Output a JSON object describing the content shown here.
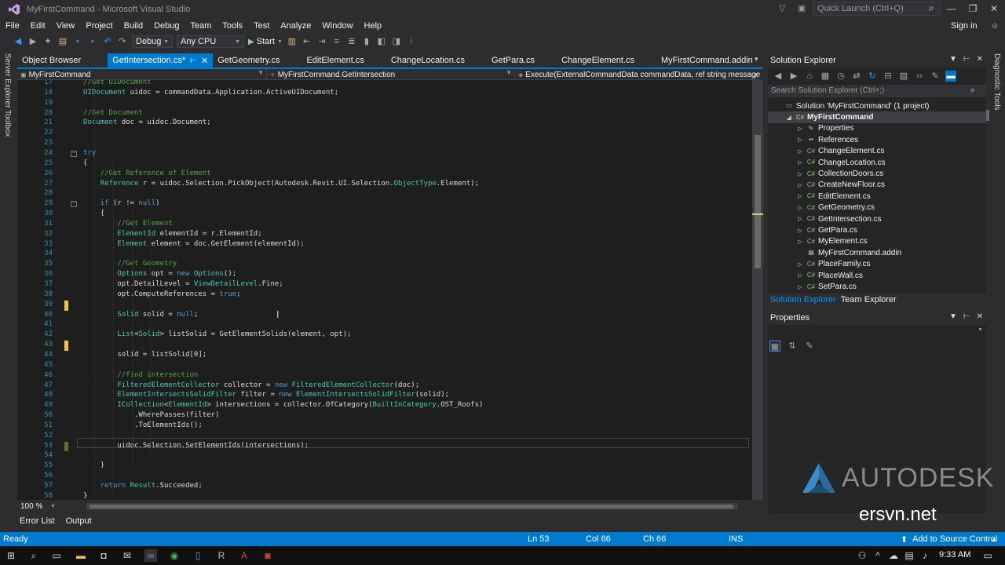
{
  "window": {
    "title": "MyFirstCommand - Microsoft Visual Studio",
    "quick_launch_placeholder": "Quick Launch (Ctrl+Q)",
    "sign_in": "Sign in"
  },
  "menu": [
    "File",
    "Edit",
    "View",
    "Project",
    "Build",
    "Debug",
    "Team",
    "Tools",
    "Test",
    "Analyze",
    "Window",
    "Help"
  ],
  "toolbar": {
    "config": "Debug",
    "platform": "Any CPU",
    "start_label": "Start"
  },
  "left_vertical_tabs": [
    "Server Explorer",
    "Toolbox"
  ],
  "right_vertical_tabs": [
    "Diagnostic Tools"
  ],
  "doc_tabs": [
    {
      "label": "Object Browser",
      "active": false
    },
    {
      "label": "GetIntersection.cs*",
      "active": true
    },
    {
      "label": "GetGeometry.cs",
      "active": false
    },
    {
      "label": "EditElement.cs",
      "active": false
    },
    {
      "label": "ChangeLocation.cs",
      "active": false
    },
    {
      "label": "GetPara.cs",
      "active": false
    },
    {
      "label": "ChangeElement.cs",
      "active": false
    },
    {
      "label": "MyFirstCommand.addin",
      "active": false
    }
  ],
  "navbar": {
    "project": "MyFirstCommand",
    "type": "MyFirstCommand.GetIntersection",
    "member": "Execute(ExternalCommandData commandData, ref string message,"
  },
  "code_lines": [
    {
      "n": "17",
      "parts": [
        {
          "t": "            //Get UIDocument",
          "c": "cm"
        }
      ]
    },
    {
      "n": "18",
      "parts": [
        {
          "t": "            ",
          "c": ""
        },
        {
          "t": "UIDocument",
          "c": "ty"
        },
        {
          "t": " uidoc = commandData.Application.ActiveUIDocument;",
          "c": ""
        }
      ]
    },
    {
      "n": "19",
      "parts": []
    },
    {
      "n": "20",
      "parts": [
        {
          "t": "            //Get Document",
          "c": "cm"
        }
      ]
    },
    {
      "n": "21",
      "parts": [
        {
          "t": "            ",
          "c": ""
        },
        {
          "t": "Document",
          "c": "ty"
        },
        {
          "t": " doc = uidoc.Document;",
          "c": ""
        }
      ]
    },
    {
      "n": "22",
      "parts": []
    },
    {
      "n": "23",
      "parts": []
    },
    {
      "n": "24",
      "parts": [
        {
          "t": "            ",
          "c": ""
        },
        {
          "t": "try",
          "c": "kw"
        }
      ]
    },
    {
      "n": "25",
      "parts": [
        {
          "t": "            {",
          "c": ""
        }
      ]
    },
    {
      "n": "26",
      "parts": [
        {
          "t": "                //Get Reference of Element",
          "c": "cm"
        }
      ]
    },
    {
      "n": "27",
      "parts": [
        {
          "t": "                ",
          "c": ""
        },
        {
          "t": "Reference",
          "c": "ty"
        },
        {
          "t": " r = uidoc.Selection.PickObject(Autodesk.Revit.UI.Selection.",
          "c": ""
        },
        {
          "t": "ObjectType",
          "c": "ty"
        },
        {
          "t": ".Element);",
          "c": ""
        }
      ]
    },
    {
      "n": "28",
      "parts": []
    },
    {
      "n": "29",
      "parts": [
        {
          "t": "                ",
          "c": ""
        },
        {
          "t": "if",
          "c": "kw"
        },
        {
          "t": " (r != ",
          "c": ""
        },
        {
          "t": "null",
          "c": "kw"
        },
        {
          "t": ")",
          "c": ""
        }
      ]
    },
    {
      "n": "30",
      "parts": [
        {
          "t": "                {",
          "c": ""
        }
      ]
    },
    {
      "n": "31",
      "parts": [
        {
          "t": "                    //Get Element",
          "c": "cm"
        }
      ]
    },
    {
      "n": "32",
      "parts": [
        {
          "t": "                    ",
          "c": ""
        },
        {
          "t": "ElementId",
          "c": "ty"
        },
        {
          "t": " elementId = r.ElementId;",
          "c": ""
        }
      ]
    },
    {
      "n": "33",
      "parts": [
        {
          "t": "                    ",
          "c": ""
        },
        {
          "t": "Element",
          "c": "ty"
        },
        {
          "t": " element = doc.GetElement(elementId);",
          "c": ""
        }
      ]
    },
    {
      "n": "34",
      "parts": []
    },
    {
      "n": "35",
      "parts": [
        {
          "t": "                    //Get Geometry",
          "c": "cm"
        }
      ]
    },
    {
      "n": "36",
      "parts": [
        {
          "t": "                    ",
          "c": ""
        },
        {
          "t": "Options",
          "c": "ty"
        },
        {
          "t": " opt = ",
          "c": ""
        },
        {
          "t": "new",
          "c": "kw"
        },
        {
          "t": " ",
          "c": ""
        },
        {
          "t": "Options",
          "c": "ty"
        },
        {
          "t": "();",
          "c": ""
        }
      ]
    },
    {
      "n": "37",
      "parts": [
        {
          "t": "                    opt.DetailLevel = ",
          "c": ""
        },
        {
          "t": "ViewDetailLevel",
          "c": "ty"
        },
        {
          "t": ".Fine;",
          "c": ""
        }
      ]
    },
    {
      "n": "38",
      "parts": [
        {
          "t": "                    opt.ComputeReferences = ",
          "c": ""
        },
        {
          "t": "true",
          "c": "kw"
        },
        {
          "t": ";",
          "c": ""
        }
      ]
    },
    {
      "n": "39",
      "parts": []
    },
    {
      "n": "40",
      "parts": [
        {
          "t": "                    ",
          "c": ""
        },
        {
          "t": "Solid",
          "c": "ty"
        },
        {
          "t": " solid = ",
          "c": ""
        },
        {
          "t": "null",
          "c": "kw"
        },
        {
          "t": ";",
          "c": ""
        }
      ]
    },
    {
      "n": "41",
      "parts": []
    },
    {
      "n": "42",
      "parts": [
        {
          "t": "                    ",
          "c": ""
        },
        {
          "t": "List",
          "c": "ty"
        },
        {
          "t": "<",
          "c": ""
        },
        {
          "t": "Solid",
          "c": "ty"
        },
        {
          "t": "> listSolid = GetElementSolids(element, opt);",
          "c": ""
        }
      ]
    },
    {
      "n": "43",
      "parts": []
    },
    {
      "n": "44",
      "parts": [
        {
          "t": "                    solid = listSolid[0];",
          "c": ""
        }
      ]
    },
    {
      "n": "45",
      "parts": []
    },
    {
      "n": "46",
      "parts": [
        {
          "t": "                    //find intersection",
          "c": "cm"
        }
      ]
    },
    {
      "n": "47",
      "parts": [
        {
          "t": "                    ",
          "c": ""
        },
        {
          "t": "FilteredElementCollector",
          "c": "ty"
        },
        {
          "t": " collector = ",
          "c": ""
        },
        {
          "t": "new",
          "c": "kw"
        },
        {
          "t": " ",
          "c": ""
        },
        {
          "t": "FilteredElementCollector",
          "c": "ty"
        },
        {
          "t": "(doc);",
          "c": ""
        }
      ]
    },
    {
      "n": "48",
      "parts": [
        {
          "t": "                    ",
          "c": ""
        },
        {
          "t": "ElementIntersectsSolidFilter",
          "c": "ty"
        },
        {
          "t": " filter = ",
          "c": ""
        },
        {
          "t": "new",
          "c": "kw"
        },
        {
          "t": " ",
          "c": ""
        },
        {
          "t": "ElementIntersectsSolidFilter",
          "c": "ty"
        },
        {
          "t": "(solid);",
          "c": ""
        }
      ]
    },
    {
      "n": "49",
      "parts": [
        {
          "t": "                    ",
          "c": ""
        },
        {
          "t": "ICollection",
          "c": "ty"
        },
        {
          "t": "<",
          "c": ""
        },
        {
          "t": "ElementId",
          "c": "ty"
        },
        {
          "t": "> intersections = collector.OfCategory(",
          "c": ""
        },
        {
          "t": "BuiltInCategory",
          "c": "ty"
        },
        {
          "t": ".OST_Roofs)",
          "c": ""
        }
      ]
    },
    {
      "n": "50",
      "parts": [
        {
          "t": "                        .WherePasses(filter)",
          "c": ""
        }
      ]
    },
    {
      "n": "51",
      "parts": [
        {
          "t": "                        .ToElementIds();",
          "c": ""
        }
      ]
    },
    {
      "n": "52",
      "parts": []
    },
    {
      "n": "53",
      "parts": [
        {
          "t": "                    uidoc.Selection.SetElementIds(intersections);",
          "c": ""
        }
      ]
    },
    {
      "n": "54",
      "parts": []
    },
    {
      "n": "55",
      "parts": [
        {
          "t": "                }",
          "c": ""
        }
      ]
    },
    {
      "n": "56",
      "parts": []
    },
    {
      "n": "57",
      "parts": [
        {
          "t": "                ",
          "c": ""
        },
        {
          "t": "return",
          "c": "kw"
        },
        {
          "t": " ",
          "c": ""
        },
        {
          "t": "Result",
          "c": "ty"
        },
        {
          "t": ".Succeeded;",
          "c": ""
        }
      ]
    },
    {
      "n": "58",
      "parts": [
        {
          "t": "            }",
          "c": ""
        }
      ]
    }
  ],
  "editor": {
    "zoom": "100 %"
  },
  "bottom_tabs": [
    "Error List",
    "Output"
  ],
  "solution_explorer": {
    "title": "Solution Explorer",
    "search_placeholder": "Search Solution Explorer (Ctrl+;)",
    "items": [
      {
        "label": "Solution 'MyFirstCommand' (1 project)",
        "indent": 0,
        "exp": "",
        "icon": "solution-icon",
        "sel": false
      },
      {
        "label": "MyFirstCommand",
        "indent": 1,
        "exp": "◢",
        "icon": "csharp-project-icon",
        "sel": true
      },
      {
        "label": "Properties",
        "indent": 2,
        "exp": "▷",
        "icon": "wrench-icon",
        "sel": false
      },
      {
        "label": "References",
        "indent": 2,
        "exp": "▷",
        "icon": "references-icon",
        "sel": false
      },
      {
        "label": "ChangeElement.cs",
        "indent": 2,
        "exp": "▷",
        "icon": "csharp-file-icon",
        "sel": false
      },
      {
        "label": "ChangeLocation.cs",
        "indent": 2,
        "exp": "▷",
        "icon": "csharp-file-icon",
        "sel": false
      },
      {
        "label": "CollectionDoors.cs",
        "indent": 2,
        "exp": "▷",
        "icon": "csharp-file-icon",
        "sel": false
      },
      {
        "label": "CreateNewFloor.cs",
        "indent": 2,
        "exp": "▷",
        "icon": "csharp-file-icon",
        "sel": false
      },
      {
        "label": "EditElement.cs",
        "indent": 2,
        "exp": "▷",
        "icon": "csharp-file-icon",
        "sel": false
      },
      {
        "label": "GetGeometry.cs",
        "indent": 2,
        "exp": "▷",
        "icon": "csharp-file-icon",
        "sel": false
      },
      {
        "label": "GetIntersection.cs",
        "indent": 2,
        "exp": "▷",
        "icon": "csharp-file-icon",
        "sel": false
      },
      {
        "label": "GetPara.cs",
        "indent": 2,
        "exp": "▷",
        "icon": "csharp-file-icon",
        "sel": false
      },
      {
        "label": "MyElement.cs",
        "indent": 2,
        "exp": "▷",
        "icon": "csharp-file-icon",
        "sel": false
      },
      {
        "label": "MyFirstCommand.addin",
        "indent": 2,
        "exp": "",
        "icon": "addin-file-icon",
        "sel": false
      },
      {
        "label": "PlaceFamily.cs",
        "indent": 2,
        "exp": "▷",
        "icon": "csharp-file-icon",
        "sel": false
      },
      {
        "label": "PlaceWall.cs",
        "indent": 2,
        "exp": "▷",
        "icon": "csharp-file-icon",
        "sel": false
      },
      {
        "label": "SetPara.cs",
        "indent": 2,
        "exp": "▷",
        "icon": "csharp-file-icon",
        "sel": false
      }
    ],
    "tabs": [
      "Solution Explorer",
      "Team Explorer"
    ]
  },
  "properties": {
    "title": "Properties"
  },
  "watermark": {
    "brand": "AUTODESK",
    "site": "ersvn.net"
  },
  "status": {
    "ready": "Ready",
    "line": "Ln 53",
    "col": "Col 66",
    "ch": "Ch 66",
    "ins": "INS",
    "source_control": "Add to Source Control"
  },
  "taskbar": {
    "time": "9:33 AM"
  },
  "colors": {
    "accent": "#007acc",
    "keyword": "#569cd6",
    "type": "#4ec9b0",
    "comment": "#57a64a",
    "line_number": "#2b91af"
  }
}
